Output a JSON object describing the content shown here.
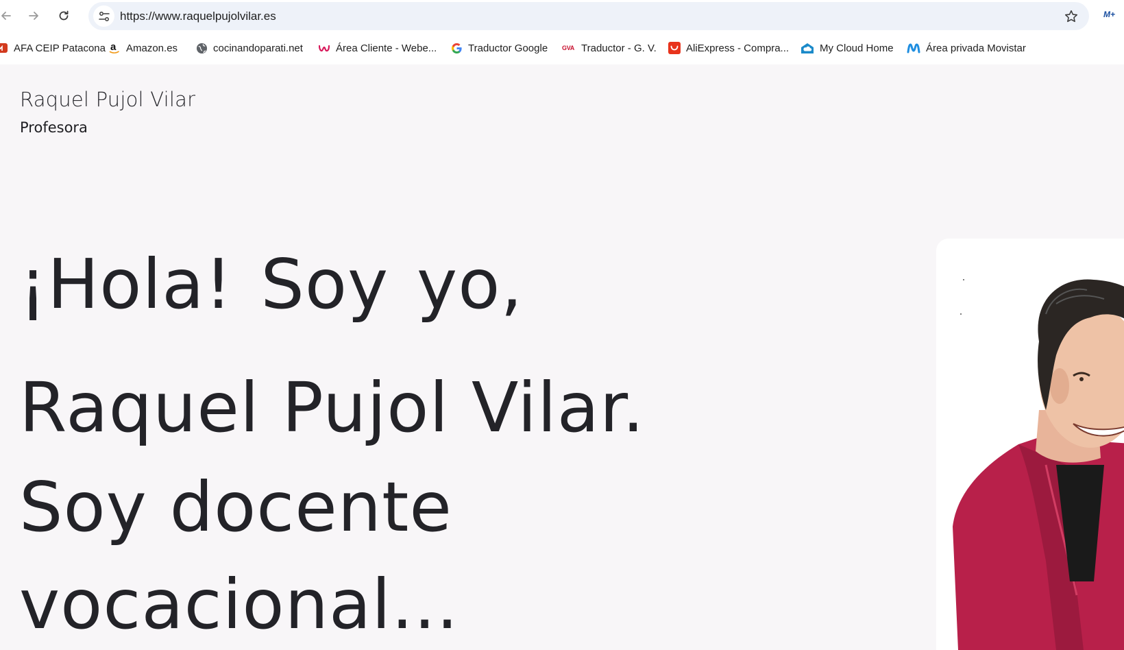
{
  "browser": {
    "url": "https://www.raquelpujolvilar.es",
    "profile_label": "M+",
    "bookmarks": [
      {
        "label": "AFA CEIP Patacona",
        "icon": "afa-icon"
      },
      {
        "label": "Amazon.es",
        "icon": "amazon-icon"
      },
      {
        "label": "cocinandoparati.net",
        "icon": "globe-icon"
      },
      {
        "label": "Área Cliente - Webe...",
        "icon": "webempresa-icon"
      },
      {
        "label": "Traductor Google",
        "icon": "google-icon"
      },
      {
        "label": "Traductor - G. V.",
        "icon": "gva-icon"
      },
      {
        "label": "AliExpress - Compra...",
        "icon": "aliexpress-icon"
      },
      {
        "label": "My Cloud Home",
        "icon": "cloud-icon"
      },
      {
        "label": "Área privada Movistar",
        "icon": "movistar-icon"
      }
    ],
    "gva_icon_text": "GVA"
  },
  "site": {
    "name": "Raquel Pujol Vilar",
    "tagline": "Profesora"
  },
  "hero": {
    "line1": "¡Hola! Soy yo,",
    "line2": "Raquel Pujol Vilar.",
    "line3": "Soy docente",
    "line4": "vocacional..."
  },
  "colors": {
    "page_background": "#f8f6f8",
    "text": "#232328",
    "jacket": "#b8204a",
    "movistar_blue": "#1f8ee0",
    "aliexpress_red": "#e8331c"
  }
}
